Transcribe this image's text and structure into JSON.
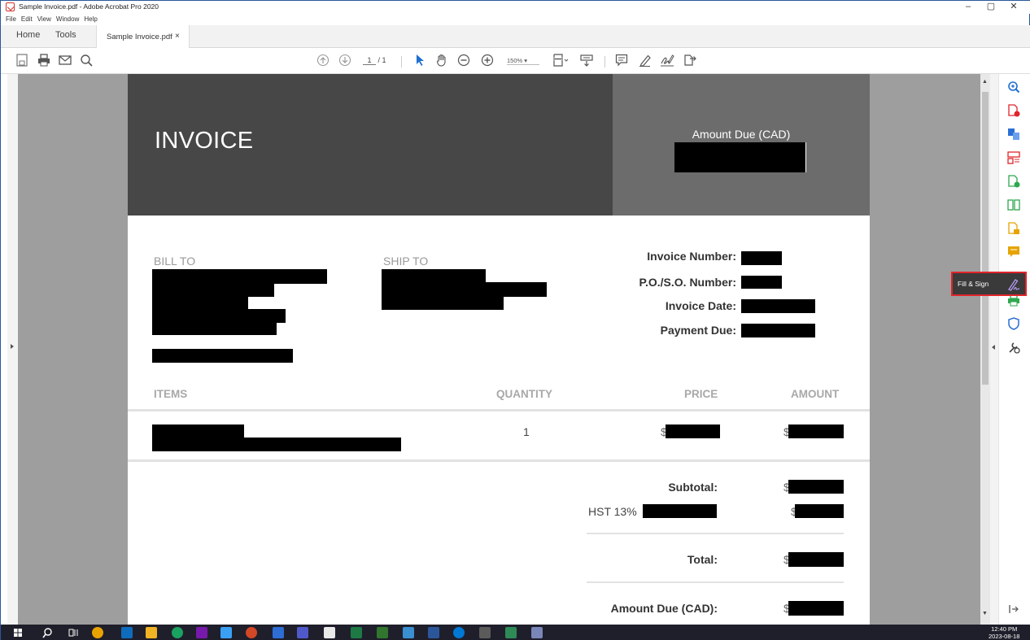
{
  "window": {
    "title": "Sample Invoice.pdf - Adobe Acrobat Pro 2020",
    "controls": [
      "–",
      "▢",
      "✕"
    ]
  },
  "menu": [
    "File",
    "Edit",
    "View",
    "Window",
    "Help"
  ],
  "tabs": {
    "home": "Home",
    "tools": "Tools",
    "document": "Sample Invoice.pdf",
    "close": "×"
  },
  "toolbar": {
    "page_current": "1",
    "page_total": "/ 1",
    "zoom": "150%"
  },
  "invoice": {
    "title": "INVOICE",
    "amount_due_label": "Amount Due (CAD)",
    "bill_to": "BILL TO",
    "ship_to": "SHIP TO",
    "invoice_number": "Invoice Number:",
    "po_number": "P.O./S.O. Number:",
    "invoice_date": "Invoice Date:",
    "payment_due": "Payment Due:",
    "col_items": "ITEMS",
    "col_quantity": "QUANTITY",
    "col_price": "PRICE",
    "col_amount": "AMOUNT",
    "item_quantity": "1",
    "currency": "$",
    "subtotal": "Subtotal:",
    "hst": "HST 13%",
    "total": "Total:",
    "amount_due_footer": "Amount Due (CAD):"
  },
  "right_panel": {
    "tooltip": "Fill & Sign",
    "icons": [
      "zoom-tool-icon",
      "create-pdf-icon",
      "export-pdf-icon",
      "organize-pages-icon",
      "edit-pdf-icon",
      "compare-icon",
      "combine-files-icon",
      "comment-icon",
      "fill-sign-icon",
      "print-production-icon",
      "protect-icon",
      "more-tools-icon",
      "expand-panel-icon"
    ]
  },
  "taskbar": {
    "time": "12:40 PM",
    "date": "2023-08-18"
  },
  "colors": {
    "header_dark": "#474747",
    "header_mid": "#6c6c6c",
    "highlight_red": "#e0242a",
    "acrobat_red": "#d4332d"
  }
}
